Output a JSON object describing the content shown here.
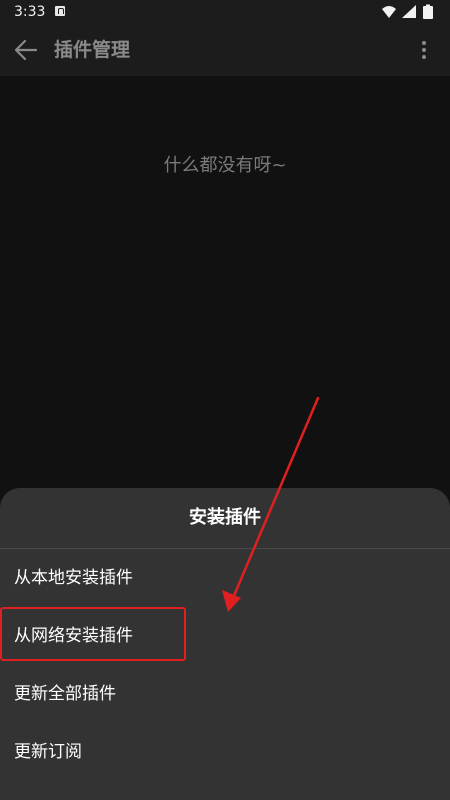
{
  "status_bar": {
    "time": "3:33"
  },
  "app_bar": {
    "title": "插件管理"
  },
  "empty_state": {
    "text": "什么都没有呀~"
  },
  "bottom_sheet": {
    "title": "安装插件",
    "items": [
      {
        "label": "从本地安装插件"
      },
      {
        "label": "从网络安装插件"
      },
      {
        "label": "更新全部插件"
      },
      {
        "label": "更新订阅"
      }
    ]
  },
  "annotation": {
    "highlighted_item": "从网络安装插件",
    "color": "#e02020"
  },
  "icons": {
    "back": "arrow-left",
    "overflow": "more-vertical",
    "wifi": "wifi",
    "signal": "cell-signal",
    "battery": "battery",
    "notification": "a-notification"
  }
}
